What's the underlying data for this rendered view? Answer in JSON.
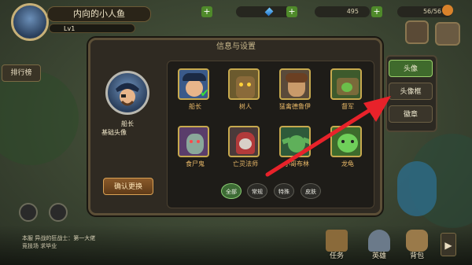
{
  "player": {
    "name": "内向的小人鱼",
    "level": "Lv1"
  },
  "resources": {
    "gold": "495",
    "stamina": "56/56"
  },
  "left_menu": {
    "rank": "排行榜"
  },
  "panel": {
    "title": "信息与设置"
  },
  "current": {
    "name": "船长",
    "subtitle": "基础头像",
    "confirm": "确认更换"
  },
  "avatars": [
    {
      "name": "船长",
      "selected": true,
      "color": "#3a5a8a"
    },
    {
      "name": "树人",
      "selected": false,
      "color": "#6b5a2e"
    },
    {
      "name": "猛禽德鲁伊",
      "selected": false,
      "color": "#5a4a3a"
    },
    {
      "name": "督军",
      "selected": false,
      "color": "#3d5a2c"
    },
    {
      "name": "食尸鬼",
      "selected": false,
      "color": "#5a3d6b"
    },
    {
      "name": "亡灵法师",
      "selected": false,
      "color": "#4a3a3a"
    },
    {
      "name": "小哥布林",
      "selected": false,
      "color": "#2e5a3a"
    },
    {
      "name": "龙龟",
      "selected": false,
      "color": "#3d6b2c"
    }
  ],
  "filters": [
    "全部",
    "常规",
    "特殊",
    "皮肤"
  ],
  "side_menu": [
    "头像",
    "头像框",
    "徽章"
  ],
  "chat": {
    "line1": "本服 异战的狂战士：第一大佬",
    "line2": "竞技场  求毕业"
  },
  "nav": [
    "任务",
    "英雄",
    "背包"
  ],
  "colors": {
    "accent_green": "#3f6a2c",
    "gold": "#c7a94e",
    "arrow": "#e8222a"
  }
}
